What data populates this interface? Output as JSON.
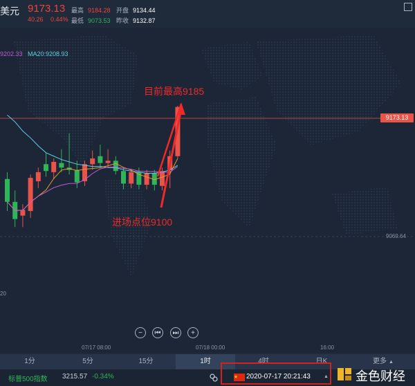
{
  "header": {
    "name": "美元",
    "price": "9173.13",
    "change_abs": "40.26",
    "change_pct": "0.44%",
    "stats": [
      {
        "label": "最高",
        "value": "9184.28",
        "tone": "red"
      },
      {
        "label": "开盘",
        "value": "9134.44",
        "tone": "white"
      },
      {
        "label": "最低",
        "value": "9073.53",
        "tone": "green"
      },
      {
        "label": "昨收",
        "value": "9132.87",
        "tone": "white"
      }
    ]
  },
  "chart": {
    "ma_left": "9202.33",
    "ma20": "MA20:9208.93",
    "price_tag": "9173.13",
    "low_tag": "9069.64",
    "side_tag": "20",
    "annotation_high": "目前最高9185",
    "annotation_entry": "进场点位9100",
    "time_labels": [
      "07/17 08:00",
      "07/18 00:00",
      "16:00"
    ],
    "zoom_controls": [
      "−",
      "⏮",
      "⏭",
      "+"
    ]
  },
  "chart_data": {
    "type": "candlestick",
    "title": "",
    "candles": [
      {
        "o": 9120,
        "c": 9100,
        "h": 9126,
        "l": 9092
      },
      {
        "o": 9100,
        "c": 9085,
        "h": 9110,
        "l": 9078
      },
      {
        "o": 9088,
        "c": 9093,
        "h": 9098,
        "l": 9078
      },
      {
        "o": 9092,
        "c": 9121,
        "h": 9124,
        "l": 9086
      },
      {
        "o": 9118,
        "c": 9126,
        "h": 9130,
        "l": 9112
      },
      {
        "o": 9133,
        "c": 9127,
        "h": 9143,
        "l": 9122
      },
      {
        "o": 9126,
        "c": 9135,
        "h": 9138,
        "l": 9120
      },
      {
        "o": 9134,
        "c": 9130,
        "h": 9146,
        "l": 9126
      },
      {
        "o": 9130,
        "c": 9128,
        "h": 9160,
        "l": 9124
      },
      {
        "o": 9128,
        "c": 9117,
        "h": 9136,
        "l": 9112
      },
      {
        "o": 9118,
        "c": 9133,
        "h": 9136,
        "l": 9114
      },
      {
        "o": 9133,
        "c": 9138,
        "h": 9145,
        "l": 9128
      },
      {
        "o": 9140,
        "c": 9134,
        "h": 9150,
        "l": 9130
      },
      {
        "o": 9134,
        "c": 9136,
        "h": 9146,
        "l": 9130
      },
      {
        "o": 9136,
        "c": 9127,
        "h": 9140,
        "l": 9124
      },
      {
        "o": 9127,
        "c": 9116,
        "h": 9130,
        "l": 9111
      },
      {
        "o": 9116,
        "c": 9126,
        "h": 9129,
        "l": 9112
      },
      {
        "o": 9126,
        "c": 9115,
        "h": 9130,
        "l": 9111
      },
      {
        "o": 9115,
        "c": 9125,
        "h": 9128,
        "l": 9111
      },
      {
        "o": 9125,
        "c": 9115,
        "h": 9128,
        "l": 9110
      },
      {
        "o": 9114,
        "c": 9127,
        "h": 9130,
        "l": 9110
      },
      {
        "o": 9128,
        "c": 9140,
        "h": 9145,
        "l": 9112
      },
      {
        "o": 9140,
        "c": 9183,
        "h": 9184,
        "l": 9138
      }
    ],
    "ma_series": [
      {
        "name": "MA20",
        "values": [
          9176,
          9170,
          9162,
          9156,
          9149,
          9143,
          9140,
          9137,
          9135,
          9133,
          9132,
          9131,
          9131,
          9130,
          9130,
          9128,
          9127,
          9126,
          9125,
          9125,
          9126,
          9128,
          9132
        ]
      }
    ]
  },
  "timeframes": [
    {
      "label": "1分",
      "active": false
    },
    {
      "label": "5分",
      "active": false
    },
    {
      "label": "15分",
      "active": false
    },
    {
      "label": "1时",
      "active": true
    },
    {
      "label": "4时",
      "active": false
    },
    {
      "label": "日K",
      "active": false
    },
    {
      "label": "更多",
      "active": false
    }
  ],
  "bottom": {
    "index_name": "标普500指数",
    "index_value": "3215.57",
    "index_change": "-0.34%",
    "datetime": "2020-07-17  20:21:43",
    "logo_text": "金色财经"
  },
  "colors": {
    "up": "#e8534a",
    "down": "#2fb45a",
    "ma_pink": "#c45bd6",
    "ma_cyan": "#5fd1e0",
    "ma_orange": "#e79a2a",
    "annotation": "#ee2a2a"
  }
}
